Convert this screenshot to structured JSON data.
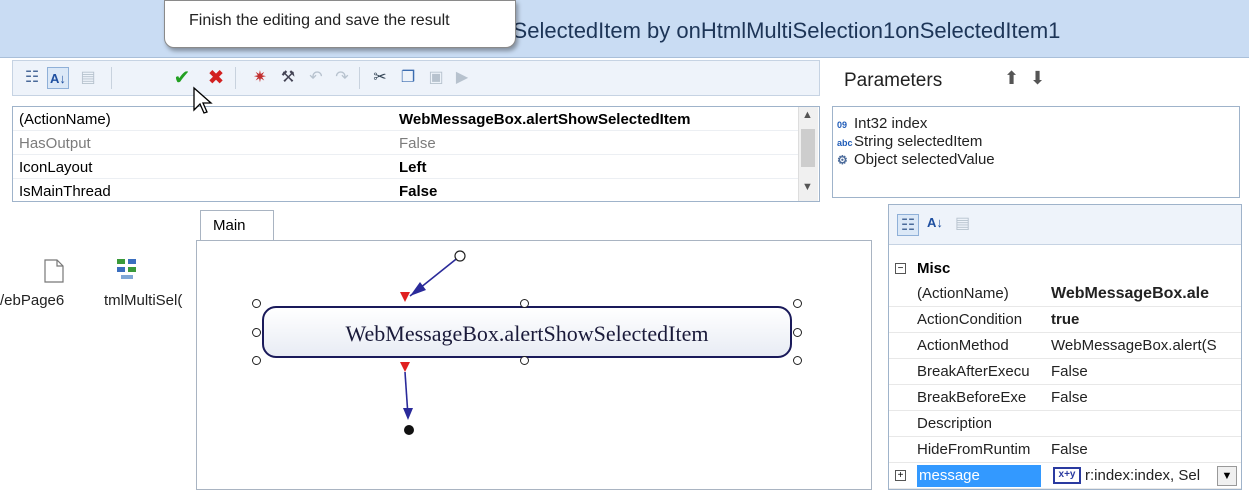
{
  "window": {
    "title": "Me                                                SelectedItem by onHtmlMultiSelection1onSelectedItem1"
  },
  "tooltip": {
    "text": "Finish the editing and save the result"
  },
  "toolbar": {
    "icons": [
      "categorized-icon",
      "alphabetical-icon",
      "property-pages-icon",
      "ok-check-icon",
      "cancel-x-icon",
      "bug-icon",
      "magic-wand-icon",
      "undo-icon",
      "redo-icon",
      "cut-icon",
      "copy-icon",
      "paste-icon",
      "run-icon"
    ]
  },
  "propgrid": {
    "rows": [
      {
        "name": "(ActionName)",
        "value": "WebMessageBox.alertShowSelectedItem"
      },
      {
        "name": "HasOutput",
        "value": "False"
      },
      {
        "name": "IconLayout",
        "value": "Left"
      },
      {
        "name": "IsMainThread",
        "value": "False"
      }
    ]
  },
  "parameters": {
    "title": "Parameters",
    "items": [
      {
        "icon": "int-icon",
        "glyph": "09",
        "label": "Int32 index"
      },
      {
        "icon": "string-icon",
        "glyph": "abc",
        "label": "String selectedItem"
      },
      {
        "icon": "object-icon",
        "glyph": "⚙",
        "label": "Object selectedValue"
      }
    ]
  },
  "leftpane": {
    "item1": "/ebPage6",
    "item2": "tmlMultiSel("
  },
  "tabs": {
    "main": "Main"
  },
  "canvas": {
    "node_label": "WebMessageBox.alertShowSelectedItem"
  },
  "rightgrid": {
    "category": "Misc",
    "rows": [
      {
        "name": "(ActionName)",
        "value": "WebMessageBox.ale"
      },
      {
        "name": "ActionCondition",
        "value": "true"
      },
      {
        "name": "ActionMethod",
        "value": "WebMessageBox.alert(S"
      },
      {
        "name": "BreakAfterExecu",
        "value": "False"
      },
      {
        "name": "BreakBeforeExe",
        "value": "False"
      },
      {
        "name": "Description",
        "value": ""
      },
      {
        "name": "HideFromRuntim",
        "value": "False"
      },
      {
        "name": "message",
        "value": "r:index:index, Sel"
      }
    ]
  },
  "colors": {
    "accent": "#3399ff",
    "title_bar": "#c9dcf3",
    "selection": "#3399ff"
  }
}
